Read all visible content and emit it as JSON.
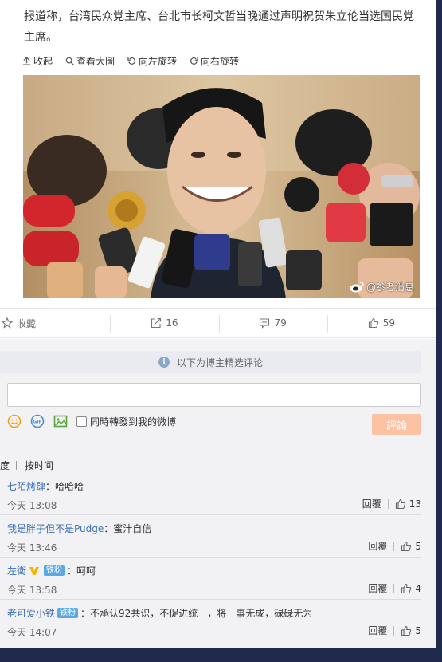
{
  "article": {
    "text": "报道称，台湾民众党主席、台北市长柯文哲当晚通过声明祝贺朱立伦当选国民党主席。"
  },
  "photo_toolbar": {
    "collapse_label": "收起",
    "view_large_label": "查看大圖",
    "rotate_left_label": "向左旋转",
    "rotate_right_label": "向右旋转"
  },
  "photo": {
    "watermark": "@参考消息"
  },
  "actions": {
    "favorite_label": "收藏",
    "repost_count": "16",
    "comment_count": "79",
    "like_count": "59"
  },
  "comments": {
    "notice": "以下为博主精选评论",
    "input_value": "",
    "sync_repost_label": "同時轉發到我的微博",
    "submit_label": "評論",
    "sort_hot_label": "度",
    "sort_time_label": "按时间",
    "reply_label": "回覆",
    "items": [
      {
        "user": "七陌烤肆",
        "text": "：哈哈哈",
        "time": "今天 13:08",
        "likes": "13",
        "vip": false,
        "fan": ""
      },
      {
        "user": "我是胖子但不是Pudge",
        "text": "：蜜汁自信",
        "time": "今天 13:46",
        "likes": "5",
        "vip": false,
        "fan": ""
      },
      {
        "user": "左衛",
        "text": "：呵呵",
        "time": "今天 13:58",
        "likes": "4",
        "vip": true,
        "fan": "铁粉"
      },
      {
        "user": "老可爱小铁",
        "text": "：不承认92共识，不促进统一，将一事无成，碌碌无为",
        "time": "今天 14:07",
        "likes": "5",
        "vip": false,
        "fan": "铁粉"
      }
    ]
  },
  "colors": {
    "user_link": "#3b6fb6",
    "submit_disabled": "#fdc1a4",
    "fan_badge": "#5aa9e6",
    "page_frame": "#1f2a4d"
  }
}
